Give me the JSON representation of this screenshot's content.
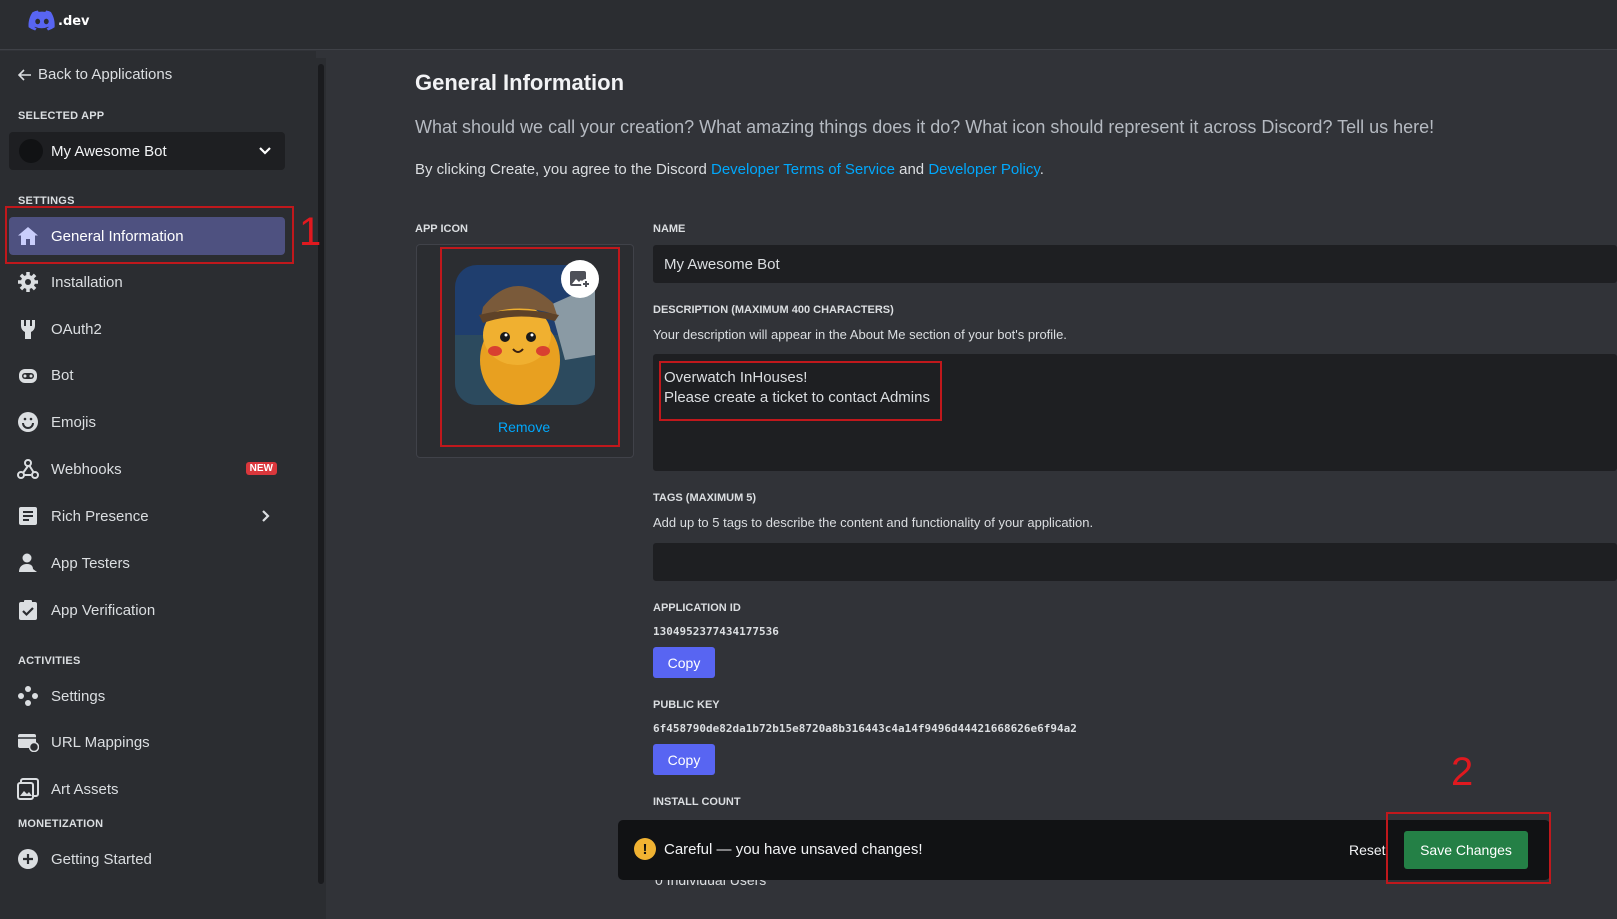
{
  "header": {
    "logo_text": ".dev"
  },
  "sidebar": {
    "back_label": "Back to Applications",
    "selected_app_label": "SELECTED APP",
    "selected_app": "My Awesome Bot",
    "settings_label": "SETTINGS",
    "settings_items": [
      {
        "label": "General Information",
        "icon": "home-icon",
        "active": true
      },
      {
        "label": "Installation",
        "icon": "gear-icon"
      },
      {
        "label": "OAuth2",
        "icon": "wrench-icon"
      },
      {
        "label": "Bot",
        "icon": "bot-icon"
      },
      {
        "label": "Emojis",
        "icon": "smile-icon"
      },
      {
        "label": "Webhooks",
        "icon": "webhook-icon",
        "badge": "NEW"
      },
      {
        "label": "Rich Presence",
        "icon": "list-icon"
      },
      {
        "label": "App Testers",
        "icon": "user-icon"
      },
      {
        "label": "App Verification",
        "icon": "clipboard-check-icon"
      }
    ],
    "activities_label": "ACTIVITIES",
    "activities_items": [
      {
        "label": "Settings",
        "icon": "gamepad-icon"
      },
      {
        "label": "URL Mappings",
        "icon": "link-icon"
      },
      {
        "label": "Art Assets",
        "icon": "image-icon"
      }
    ],
    "monetization_label": "MONETIZATION",
    "monetization_items": [
      {
        "label": "Getting Started",
        "icon": "plus-circle-icon"
      }
    ]
  },
  "main": {
    "title": "General Information",
    "lead": "What should we call your creation? What amazing things does it do? What icon should represent it across Discord? Tell us here!",
    "terms_prefix": "By clicking Create, you agree to the Discord ",
    "terms_link1": "Developer Terms of Service",
    "terms_and": " and ",
    "terms_link2": "Developer Policy",
    "terms_suffix": ".",
    "app_icon_label": "APP ICON",
    "remove_label": "Remove",
    "name_label": "NAME",
    "name_value": "My Awesome Bot",
    "description_label": "DESCRIPTION (MAXIMUM 400 CHARACTERS)",
    "description_help": "Your description will appear in the About Me section of your bot's profile.",
    "description_line1": "Overwatch InHouses!",
    "description_line2": "Please create a ticket to contact Admins",
    "tags_label": "TAGS (MAXIMUM 5)",
    "tags_help": "Add up to 5 tags to describe the content and functionality of your application.",
    "app_id_label": "APPLICATION ID",
    "app_id": "1304952377434177536",
    "copy_label": "Copy",
    "public_key_label": "PUBLIC KEY",
    "public_key": "6f458790de82da1b72b15e8720a8b316443c4a14f9496d44421668626e6f94a2",
    "install_count_label": "INSTALL COUNT",
    "install_peek": "0 Individual Users"
  },
  "unsaved_bar": {
    "message": "Careful — you have unsaved changes!",
    "reset_label": "Reset",
    "save_label": "Save Changes"
  },
  "annotations": {
    "marker_1": "1",
    "marker_2": "2"
  },
  "colors": {
    "accent": "#5865f2",
    "link": "#00a8fc",
    "save": "#248046",
    "annotation": "#c0181c"
  }
}
